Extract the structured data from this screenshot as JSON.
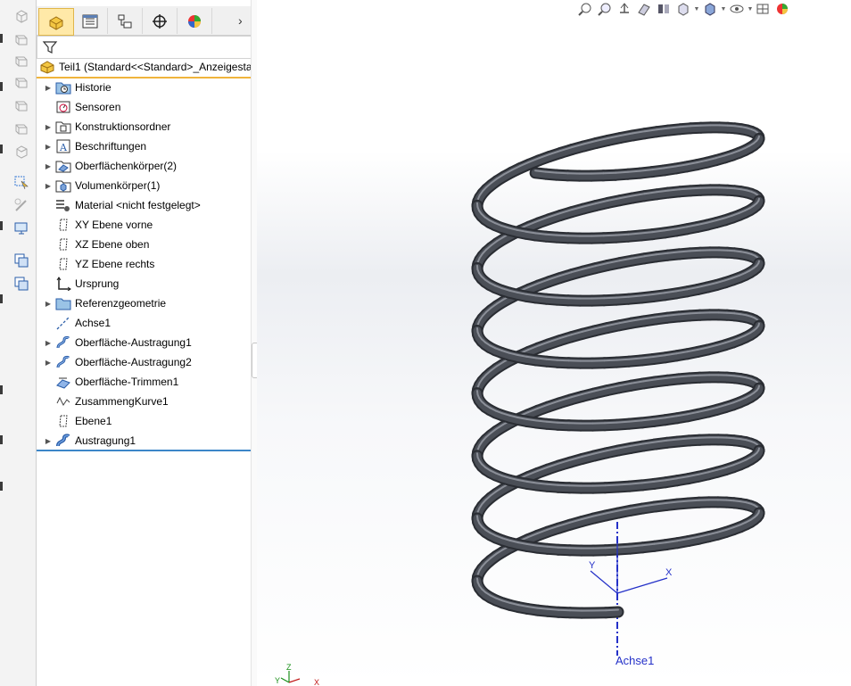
{
  "feature_tree": {
    "root": {
      "label": "Teil1  (Standard<<Standard>_Anzeigesta"
    },
    "items": [
      {
        "label": "Historie",
        "icon": "history-folder-icon",
        "expandable": true
      },
      {
        "label": "Sensoren",
        "icon": "sensor-icon",
        "expandable": false
      },
      {
        "label": "Konstruktionsordner",
        "icon": "design-binder-icon",
        "expandable": true
      },
      {
        "label": "Beschriftungen",
        "icon": "annotations-icon",
        "expandable": true
      },
      {
        "label": "Oberflächenkörper(2)",
        "icon": "surface-bodies-icon",
        "expandable": true
      },
      {
        "label": "Volumenkörper(1)",
        "icon": "solid-bodies-icon",
        "expandable": true
      },
      {
        "label": "Material <nicht festgelegt>",
        "icon": "material-icon",
        "expandable": false
      },
      {
        "label": "XY Ebene vorne",
        "icon": "plane-icon",
        "expandable": false
      },
      {
        "label": "XZ Ebene oben",
        "icon": "plane-icon",
        "expandable": false
      },
      {
        "label": "YZ Ebene rechts",
        "icon": "plane-icon",
        "expandable": false
      },
      {
        "label": "Ursprung",
        "icon": "origin-icon",
        "expandable": false
      },
      {
        "label": "Referenzgeometrie",
        "icon": "folder-icon",
        "expandable": true
      },
      {
        "label": "Achse1",
        "icon": "axis-icon",
        "expandable": false
      },
      {
        "label": "Oberfläche-Austragung1",
        "icon": "surface-sweep-icon",
        "expandable": true
      },
      {
        "label": "Oberfläche-Austragung2",
        "icon": "surface-sweep-icon",
        "expandable": true
      },
      {
        "label": "Oberfläche-Trimmen1",
        "icon": "surface-trim-icon",
        "expandable": false
      },
      {
        "label": "ZusammengKurve1",
        "icon": "composite-curve-icon",
        "expandable": false
      },
      {
        "label": "Ebene1",
        "icon": "plane-icon",
        "expandable": false
      },
      {
        "label": "Austragung1",
        "icon": "sweep-icon",
        "expandable": true
      }
    ]
  },
  "viewport": {
    "axis_label": "Achse1",
    "triad": {
      "x": "X",
      "y": "Y",
      "z": "Z"
    },
    "origin_triad": {
      "x": "X",
      "y": "Y"
    }
  },
  "colors": {
    "accent_active_tab": "#ffe9a8",
    "root_underline": "#f0b43c",
    "rollback_bar": "#3c86c8",
    "spring": "#4a4e56",
    "axis": "#2430c8"
  }
}
